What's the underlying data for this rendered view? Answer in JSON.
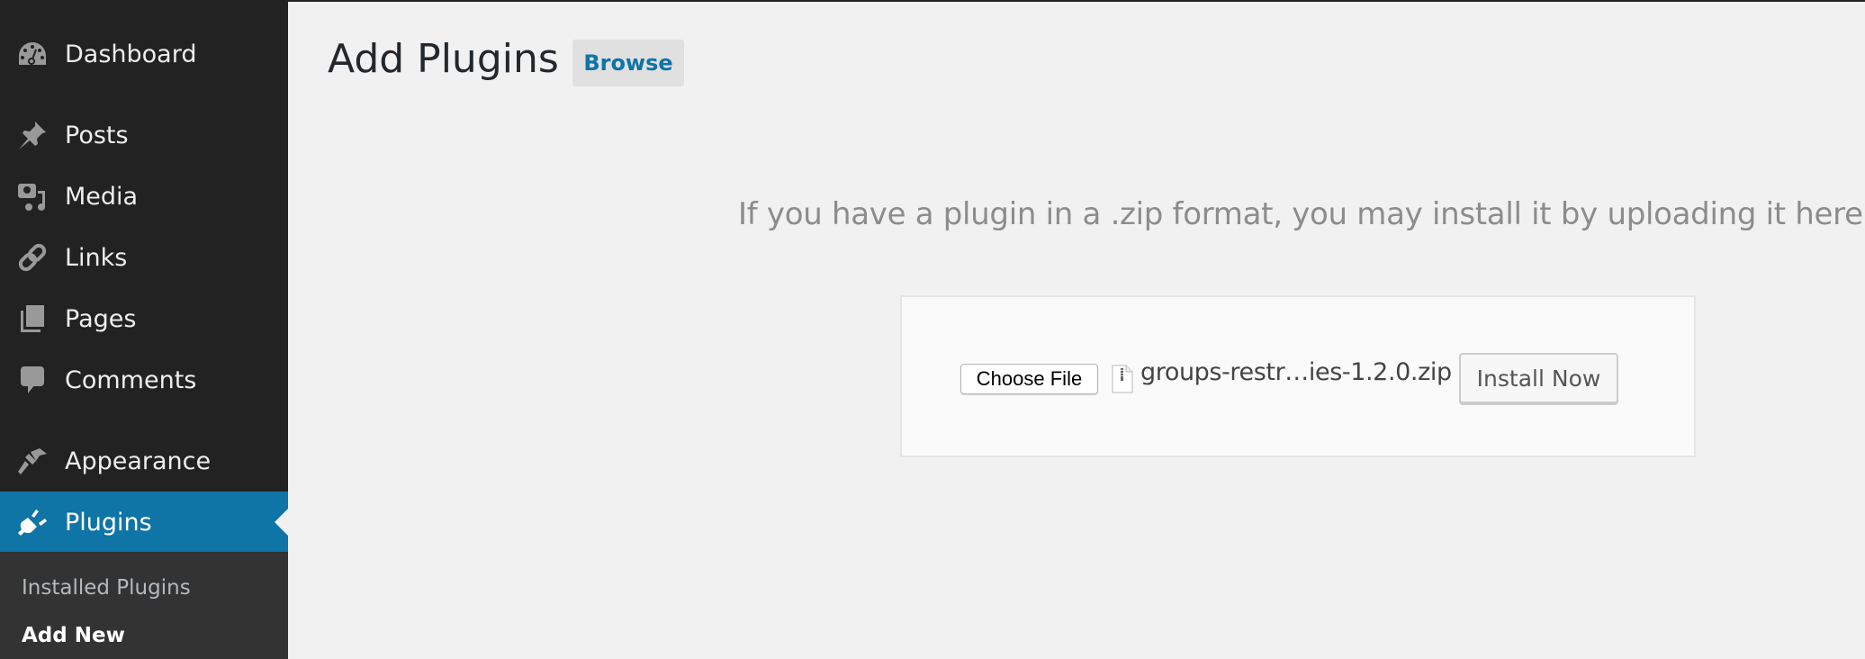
{
  "sidebar": {
    "items": [
      {
        "label": "Dashboard",
        "icon": "dashboard-icon"
      },
      {
        "label": "Posts",
        "icon": "pin-icon"
      },
      {
        "label": "Media",
        "icon": "media-icon"
      },
      {
        "label": "Links",
        "icon": "link-icon"
      },
      {
        "label": "Pages",
        "icon": "pages-icon"
      },
      {
        "label": "Comments",
        "icon": "comment-icon"
      },
      {
        "label": "Appearance",
        "icon": "paintbrush-icon"
      },
      {
        "label": "Plugins",
        "icon": "plugin-icon",
        "active": true
      }
    ],
    "submenu": [
      {
        "label": "Installed Plugins"
      },
      {
        "label": "Add New",
        "current": true
      }
    ],
    "colors": {
      "background": "#222222",
      "active": "#0f74a6",
      "submenu": "#333333"
    }
  },
  "header": {
    "title": "Add Plugins",
    "browse_label": "Browse"
  },
  "upload": {
    "help_text": "If you have a plugin in a .zip format, you may install it by uploading it here.",
    "choose_file_label": "Choose File",
    "selected_file": "groups-restr…ies-1.2.0.zip",
    "install_label": "Install Now"
  }
}
